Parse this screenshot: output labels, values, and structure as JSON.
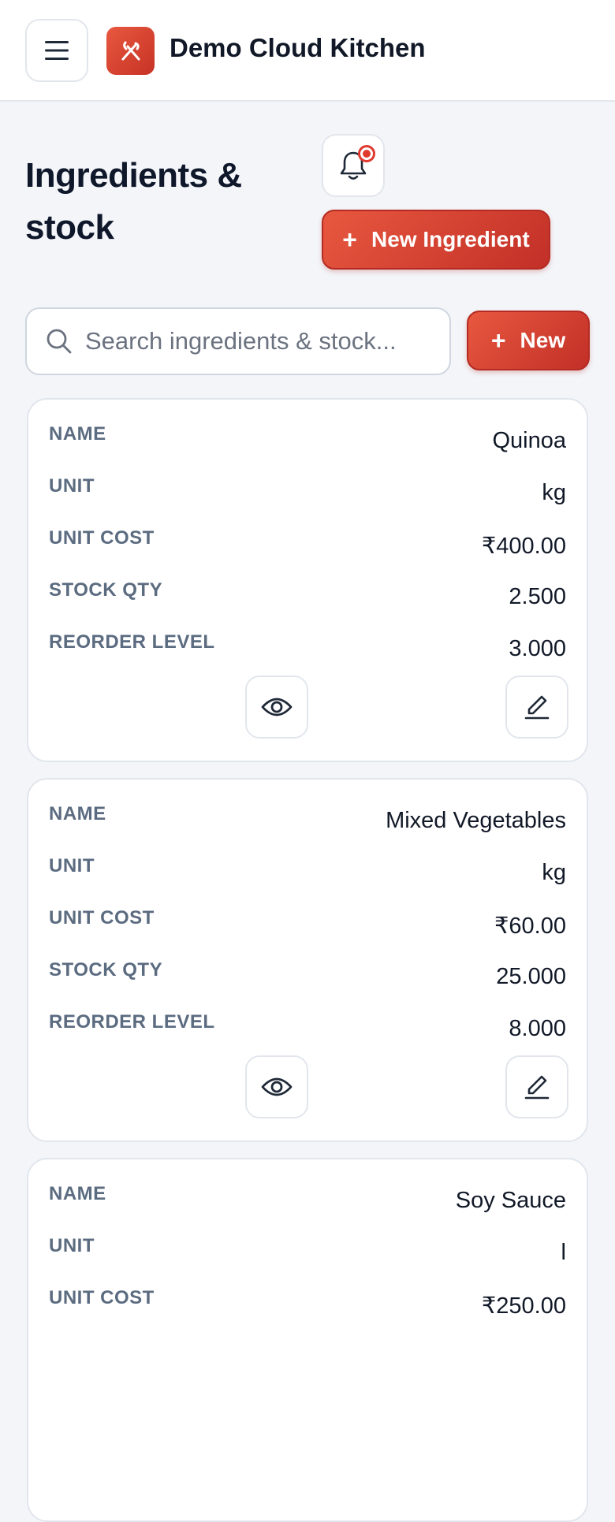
{
  "header": {
    "app_title": "Demo Cloud Kitchen",
    "menu_icon": "hamburger-menu-icon",
    "logo_icon": "fork-knife-icon"
  },
  "page": {
    "title": "Ingredients & stock",
    "notification_icon": "bell-icon",
    "new_ingredient_label": "New Ingredient",
    "new_label": "New"
  },
  "search": {
    "placeholder": "Search ingredients & stock...",
    "value": ""
  },
  "field_labels": {
    "name": "NAME",
    "unit": "UNIT",
    "unit_cost": "UNIT COST",
    "stock_qty": "STOCK QTY",
    "reorder_level": "REORDER LEVEL"
  },
  "ingredients": [
    {
      "name": "Quinoa",
      "unit": "kg",
      "unit_cost": "₹400.00",
      "stock_qty": "2.500",
      "reorder_level": "3.000"
    },
    {
      "name": "Mixed Vegetables",
      "unit": "kg",
      "unit_cost": "₹60.00",
      "stock_qty": "25.000",
      "reorder_level": "8.000"
    },
    {
      "name": "Soy Sauce",
      "unit": "l",
      "unit_cost": "₹250.00",
      "stock_qty": "",
      "reorder_level": ""
    }
  ],
  "colors": {
    "accent": "#d9432f",
    "label": "#5b6b80",
    "background": "#f3f5f9"
  }
}
